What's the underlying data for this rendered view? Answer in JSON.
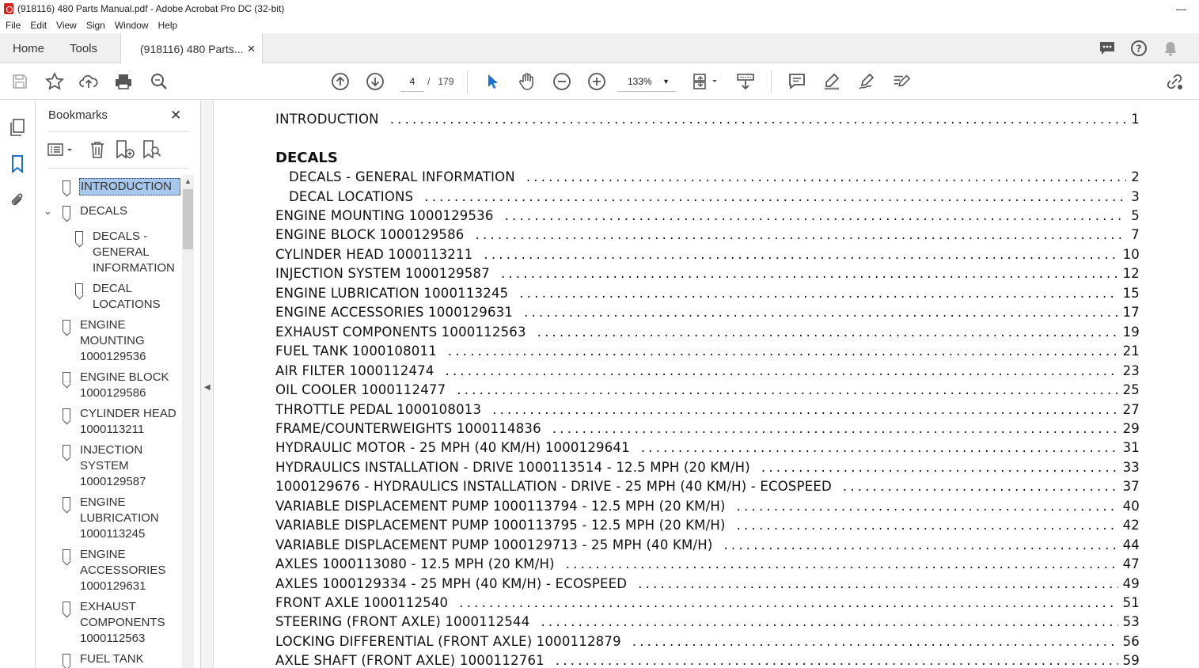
{
  "window": {
    "title": "(918116) 480 Parts Manual.pdf - Adobe Acrobat Pro DC (32-bit)"
  },
  "menu": [
    "File",
    "Edit",
    "View",
    "Sign",
    "Window",
    "Help"
  ],
  "tabs": {
    "home": "Home",
    "tools": "Tools",
    "doc": "(918116) 480 Parts..."
  },
  "toolbar": {
    "page_current": "4",
    "page_sep": "/",
    "page_total": "179",
    "zoom": "133%"
  },
  "bookmarks": {
    "title": "Bookmarks",
    "items": [
      {
        "label": "INTRODUCTION",
        "selected": true
      },
      {
        "label": "DECALS",
        "expanded": true
      },
      {
        "label": "DECALS -\nGENERAL\nINFORMATION"
      },
      {
        "label": "DECAL\nLOCATIONS"
      },
      {
        "label": "ENGINE\nMOUNTING\n1000129536"
      },
      {
        "label": "ENGINE BLOCK\n1000129586"
      },
      {
        "label": "CYLINDER HEAD\n1000113211"
      },
      {
        "label": "INJECTION\nSYSTEM\n1000129587"
      },
      {
        "label": "ENGINE\nLUBRICATION\n1000113245"
      },
      {
        "label": "ENGINE\nACCESSORIES\n1000129631"
      },
      {
        "label": "EXHAUST\nCOMPONENTS\n1000112563"
      },
      {
        "label": "FUEL TANK"
      }
    ]
  },
  "toc": {
    "intro": {
      "label": "INTRODUCTION",
      "page": "1"
    },
    "section": "DECALS",
    "sub": [
      {
        "label": "DECALS - GENERAL INFORMATION",
        "page": "2"
      },
      {
        "label": "DECAL LOCATIONS",
        "page": "3"
      }
    ],
    "entries": [
      {
        "label": "ENGINE MOUNTING 1000129536",
        "page": "5"
      },
      {
        "label": "ENGINE BLOCK 1000129586",
        "page": "7"
      },
      {
        "label": "CYLINDER HEAD 1000113211",
        "page": "10"
      },
      {
        "label": "INJECTION SYSTEM 1000129587",
        "page": "12"
      },
      {
        "label": "ENGINE LUBRICATION 1000113245",
        "page": "15"
      },
      {
        "label": "ENGINE ACCESSORIES 1000129631",
        "page": "17"
      },
      {
        "label": "EXHAUST COMPONENTS 1000112563",
        "page": "19"
      },
      {
        "label": "FUEL TANK 1000108011",
        "page": "21"
      },
      {
        "label": "AIR FILTER 1000112474",
        "page": "23"
      },
      {
        "label": "OIL COOLER 1000112477",
        "page": "25"
      },
      {
        "label": "THROTTLE PEDAL 1000108013",
        "page": "27"
      },
      {
        "label": "FRAME/COUNTERWEIGHTS 1000114836",
        "page": "29"
      },
      {
        "label": "HYDRAULIC MOTOR - 25 MPH (40 KM/H) 1000129641",
        "page": "31"
      },
      {
        "label": "HYDRAULICS INSTALLATION - DRIVE 1000113514 - 12.5 MPH (20 KM/H)",
        "page": "33"
      },
      {
        "label": "1000129676  - HYDRAULICS INSTALLATION - DRIVE - 25 MPH (40 KM/H) - ECOSPEED",
        "page": "37"
      },
      {
        "label": "VARIABLE DISPLACEMENT PUMP 1000113794 - 12.5 MPH (20 KM/H)",
        "page": "40"
      },
      {
        "label": "VARIABLE DISPLACEMENT PUMP 1000113795 - 12.5 MPH (20 KM/H)",
        "page": "42"
      },
      {
        "label": "VARIABLE DISPLACEMENT PUMP 1000129713 - 25 MPH (40 KM/H)",
        "page": "44"
      },
      {
        "label": "AXLES 1000113080 - 12.5 MPH (20 KM/H)",
        "page": "47"
      },
      {
        "label": "AXLES 1000129334 - 25 MPH (40 KM/H) - ECOSPEED",
        "page": "49"
      },
      {
        "label": "FRONT AXLE 1000112540",
        "page": "51"
      },
      {
        "label": "STEERING (FRONT AXLE) 1000112544",
        "page": "53"
      },
      {
        "label": "LOCKING DIFFERENTIAL (FRONT AXLE) 1000112879",
        "page": "56"
      },
      {
        "label": "AXLE SHAFT (FRONT AXLE) 1000112761",
        "page": "59"
      }
    ]
  }
}
